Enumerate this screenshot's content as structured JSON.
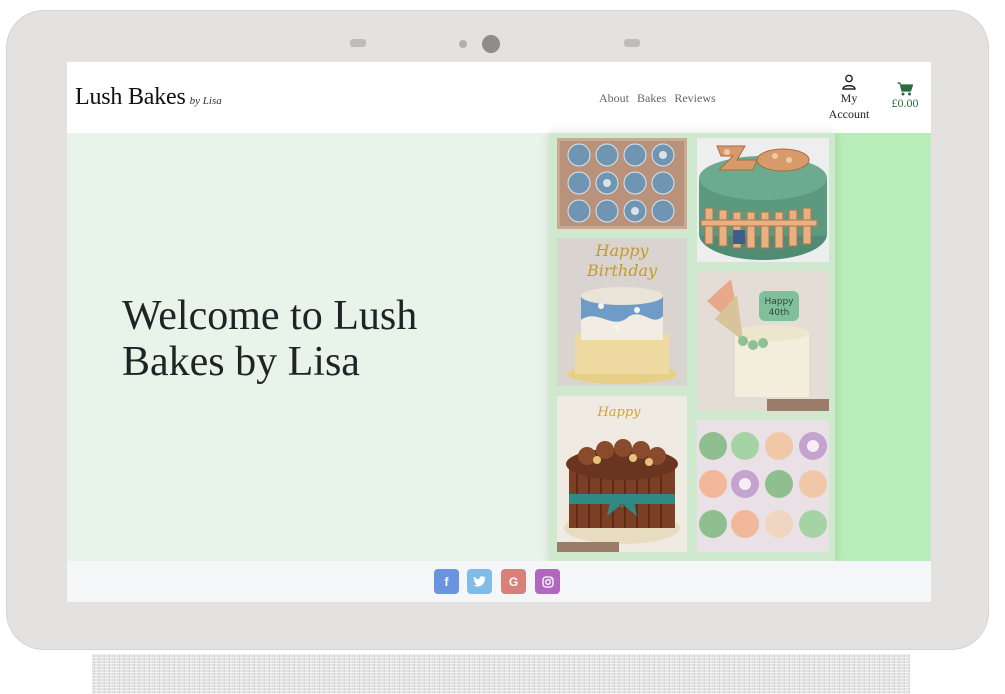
{
  "brand": {
    "name": "Lush Bakes",
    "tagline": "by Lisa"
  },
  "nav": {
    "links": [
      {
        "label": "About"
      },
      {
        "label": "Bakes"
      },
      {
        "label": "Reviews"
      }
    ]
  },
  "account": {
    "line1": "My",
    "line2": "Account",
    "icon": "user-icon"
  },
  "cart": {
    "total": "£0.00",
    "icon": "shopping-cart-icon"
  },
  "hero": {
    "title": "Welcome to Lush Bakes by Lisa"
  },
  "gallery": {
    "images": [
      {
        "name": "cupcakes-blue-dozen"
      },
      {
        "name": "cake-number-21-fence"
      },
      {
        "name": "cake-happy-birthday-blue-waves"
      },
      {
        "name": "cake-happy-40th-cream"
      },
      {
        "name": "cake-chocolate-drip"
      },
      {
        "name": "cupcakes-pastel-mix"
      }
    ]
  },
  "footer": {
    "social": [
      {
        "name": "facebook",
        "glyph": "f",
        "color": "#6a93e0"
      },
      {
        "name": "twitter",
        "glyph": "t",
        "color": "#7fbce8"
      },
      {
        "name": "google",
        "glyph": "G",
        "color": "#d9807a"
      },
      {
        "name": "instagram",
        "glyph": "◎",
        "color": "#b067bd"
      }
    ]
  },
  "colors": {
    "hero_bg": "#e8f3e9",
    "accent_green": "#b8ecb8",
    "cart_green": "#2c6b3d"
  }
}
